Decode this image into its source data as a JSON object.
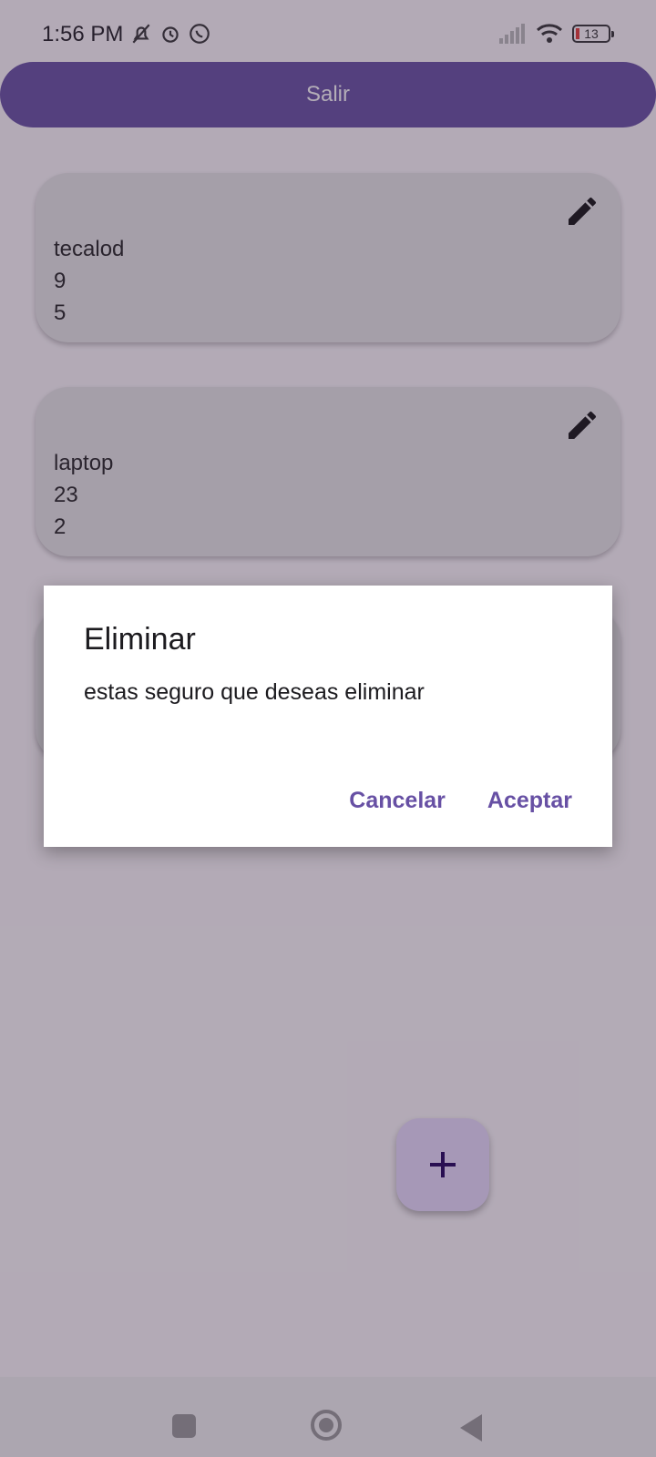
{
  "status_bar": {
    "time": "1:56 PM",
    "battery_level": "13",
    "left_icons": [
      "bell-off-icon",
      "alarm-icon",
      "whatsapp-icon"
    ],
    "right_icons": [
      "signal-icon",
      "wifi-icon",
      "battery-icon"
    ]
  },
  "header": {
    "button_label": "Salir"
  },
  "cards": [
    {
      "name": "tecalod",
      "value_1": "9",
      "value_2": "5",
      "icon": "pencil-icon"
    },
    {
      "name": "laptop",
      "value_1": "23",
      "value_2": "2",
      "icon": "pencil-icon"
    }
  ],
  "fab": {
    "icon": "plus-icon"
  },
  "dialog": {
    "title": "Eliminar",
    "message": "estas seguro que deseas eliminar",
    "cancel_label": "Cancelar",
    "accept_label": "Aceptar"
  },
  "nav_bar": {
    "icons": [
      "recents-square-icon",
      "home-circle-icon",
      "back-triangle-icon"
    ]
  },
  "colors": {
    "primary": "#6750a4",
    "fab_background": "#eaddff",
    "card_background": "#e8e8e8",
    "scrim": "#382842"
  }
}
